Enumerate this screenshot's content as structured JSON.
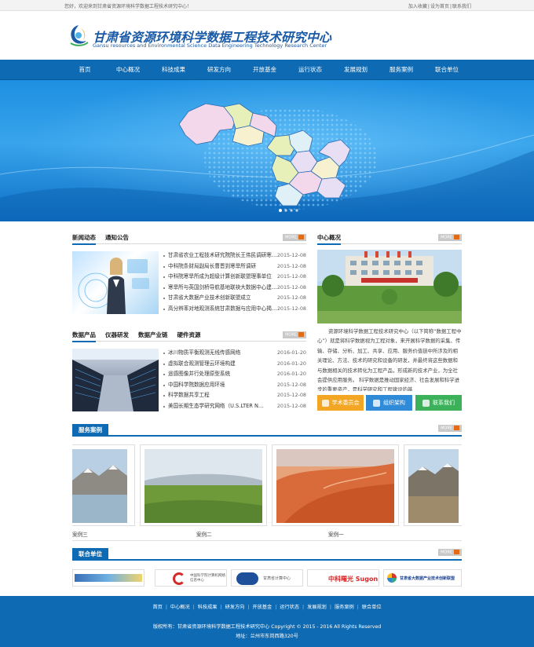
{
  "topbar": {
    "welcome": "您好，欢迎来到甘肃省资源环境科学数据工程技术研究中心！",
    "links": [
      "加入收藏",
      "设为首页",
      "联系我们"
    ]
  },
  "header": {
    "title_cn": "甘肃省资源环境科学数据工程技术研究中心",
    "title_en": "Gansu resources and Environmental Science Data Engineering Technology Research Center"
  },
  "nav": [
    "首页",
    "中心概况",
    "科技成果",
    "研发方向",
    "开放基金",
    "运行状态",
    "发展规划",
    "服务案例",
    "联合单位"
  ],
  "news": {
    "tabs": [
      "新闻动态",
      "通知公告"
    ],
    "more": "MORE",
    "items": [
      {
        "title": "甘肃省农业工程技术研究院院长王伟民调研寒…",
        "date": "2015-12-08"
      },
      {
        "title": "中科院条财局副局长曹晋到寒旱所调研",
        "date": "2015-12-08"
      },
      {
        "title": "中科院寒旱所成为超级计算创新联盟理事单位",
        "date": "2015-12-08"
      },
      {
        "title": "寒旱所与英国剑桥导航基地联袂大数据中心建…",
        "date": "2015-12-08"
      },
      {
        "title": "甘肃省大数据产业技术创新联盟成立",
        "date": "2015-12-08"
      },
      {
        "title": "高分辨率对地观测系统甘肃数据与应用中心揭…",
        "date": "2015-12-08"
      }
    ]
  },
  "data_products": {
    "tabs": [
      "数据产品",
      "仪器研发",
      "数据产业链",
      "硬件资源"
    ],
    "more": "MORE",
    "items": [
      {
        "title": "冰川物质平衡观测无线传感网络",
        "date": "2016-01-20"
      },
      {
        "title": "虚拟联合观测管理云环境构建",
        "date": "2016-01-20"
      },
      {
        "title": "遥感图像并行处理原型系统",
        "date": "2016-01-20"
      },
      {
        "title": "中国科学院数据应用环境",
        "date": "2015-12-08"
      },
      {
        "title": "科学数据共享工程",
        "date": "2015-12-08"
      },
      {
        "title": "美国长期生态学研究网络（U.S.LTER N…",
        "date": "2015-12-08"
      }
    ]
  },
  "overview": {
    "title": "中心概况",
    "more": "MORE",
    "text": "资源环境科学数据工程技术研究中心（以下简称“数据工程中心”）就是将科学数据视为工程对象，来开展科学数据的采集、传输、存储、分析、加工、共享、应用、服务价值链中所涉及的相关理论、方法、技术的研究和设备的研发，并最终将这些数据和与数据相关的技术转化为工程产品，形成新的技术产业，为全社会提供应用服务。 科学数据是推动国家经济、社会发展和科学进步的重要资产，是科学研究和工程建设的基",
    "buttons": [
      {
        "label": "学术委员会",
        "color": "#f3a623"
      },
      {
        "label": "组织架构",
        "color": "#2f8ad8"
      },
      {
        "label": "联系我们",
        "color": "#3bb159"
      }
    ]
  },
  "cases": {
    "title": "服务案例",
    "more": "MORE",
    "labels": [
      "案例三",
      "案例二",
      "案例一"
    ]
  },
  "partners": {
    "title": "联合单位",
    "more": "MORE",
    "items": [
      "",
      "中国科学院计算机网络信息中心",
      "甘肃省计算中心",
      "中科曙光 Sugon",
      "甘肃省大数据产业技术创新联盟"
    ]
  },
  "footer": {
    "links": [
      "首页",
      "中心概况",
      "科技成果",
      "研发方向",
      "开放基金",
      "运行状态",
      "发展规划",
      "服务案例",
      "联合单位"
    ],
    "copyright": "版权所有：甘肃省资源环境科学数据工程技术研究中心    Copyright © 2015 - 2016   All Rights Reserved",
    "address": "地址：兰州市东岗西路320号"
  }
}
